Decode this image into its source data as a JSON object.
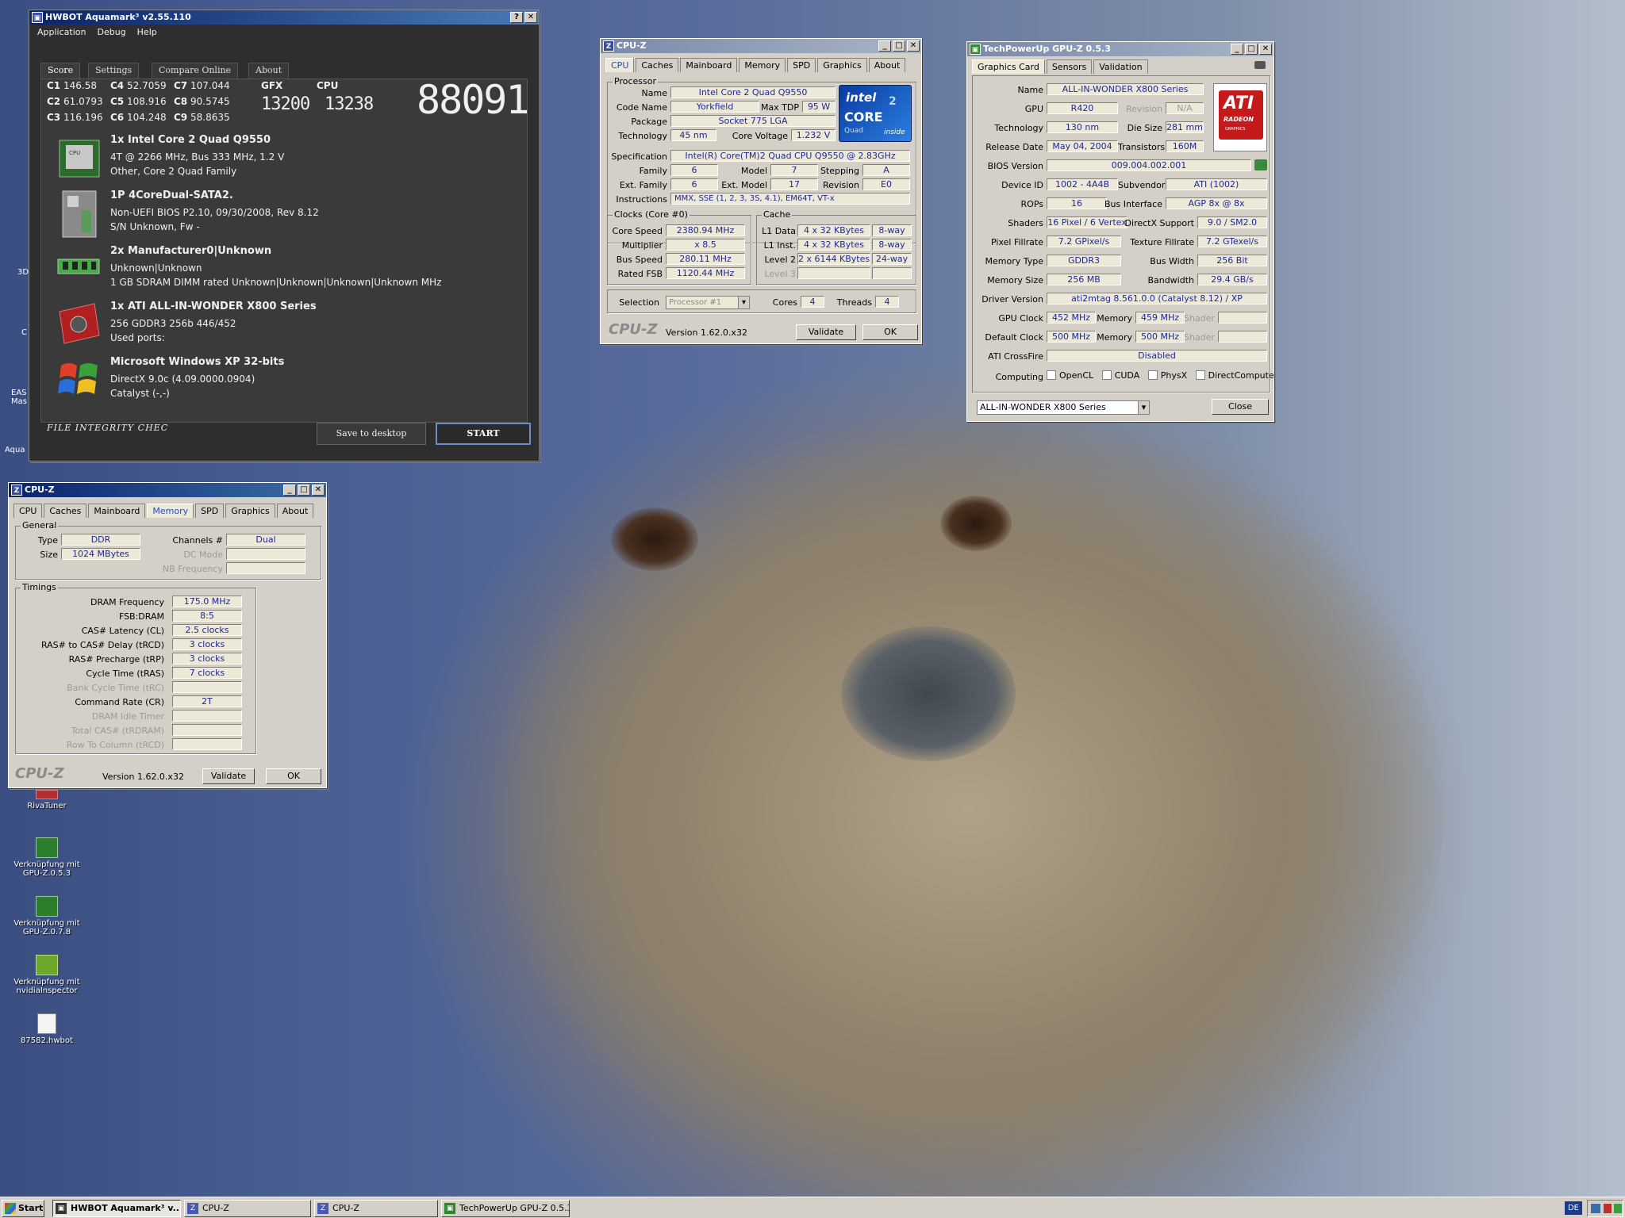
{
  "aquamark": {
    "title": "HWBOT Aquamark³ v2.55.110",
    "menu": [
      "Application",
      "Debug",
      "Help"
    ],
    "tabs": [
      "Score",
      "Settings",
      "Compare Online",
      "About"
    ],
    "scores": [
      {
        "k": "C1",
        "v": "146.58"
      },
      {
        "k": "C4",
        "v": "52.7059"
      },
      {
        "k": "C7",
        "v": "107.044"
      },
      {
        "k": "C2",
        "v": "61.0793"
      },
      {
        "k": "C5",
        "v": "108.916"
      },
      {
        "k": "C8",
        "v": "90.5745"
      },
      {
        "k": "C3",
        "v": "116.196"
      },
      {
        "k": "C6",
        "v": "104.248"
      },
      {
        "k": "C9",
        "v": "58.8635"
      }
    ],
    "gfx_label": "GFX",
    "cpu_label": "CPU",
    "gfx": "13200",
    "cpu": "13238",
    "total": "88091",
    "hw": [
      {
        "t": "1x Intel Core 2 Quad  Q9550",
        "l": [
          "4T @ 2266 MHz, Bus 333 MHz, 1.2 V",
          "Other, Core 2 Quad Family"
        ]
      },
      {
        "t": "1P  4CoreDual-SATA2.",
        "l": [
          "Non-UEFI BIOS P2.10, 09/30/2008, Rev 8.12",
          "S/N Unknown, Fw -"
        ]
      },
      {
        "t": "2x Manufacturer0|Unknown",
        "l": [
          "Unknown|Unknown",
          "1 GB SDRAM DIMM rated Unknown|Unknown|Unknown|Unknown MHz"
        ]
      },
      {
        "t": "1x ATI ALL-IN-WONDER X800 Series",
        "l": [
          "256 GDDR3 256b 446/452",
          "Used ports:"
        ]
      },
      {
        "t": "Microsoft Windows XP 32-bits",
        "l": [
          "DirectX 9.0c (4.09.0000.0904)",
          "Catalyst (-,-)"
        ]
      }
    ],
    "integrity": "FILE INTEGRITY CHEC",
    "save": "Save to desktop",
    "start": "START"
  },
  "cpuz_mem": {
    "title": "CPU-Z",
    "tabs": [
      "CPU",
      "Caches",
      "Mainboard",
      "Memory",
      "SPD",
      "Graphics",
      "About"
    ],
    "general": "General",
    "timings": "Timings",
    "type_l": "Type",
    "type": "DDR",
    "size_l": "Size",
    "size": "1024 MBytes",
    "ch_l": "Channels #",
    "ch": "Dual",
    "dc_l": "DC Mode",
    "nb_l": "NB Frequency",
    "rows": [
      {
        "l": "DRAM Frequency",
        "v": "175.0 MHz"
      },
      {
        "l": "FSB:DRAM",
        "v": "8:5"
      },
      {
        "l": "CAS# Latency (CL)",
        "v": "2.5 clocks"
      },
      {
        "l": "RAS# to CAS# Delay (tRCD)",
        "v": "3 clocks"
      },
      {
        "l": "RAS# Precharge (tRP)",
        "v": "3 clocks"
      },
      {
        "l": "Cycle Time (tRAS)",
        "v": "7 clocks"
      },
      {
        "l": "Bank Cycle Time (tRC)",
        "v": ""
      },
      {
        "l": "Command Rate (CR)",
        "v": "2T"
      },
      {
        "l": "DRAM Idle Timer",
        "v": ""
      },
      {
        "l": "Total CAS# (tRDRAM)",
        "v": ""
      },
      {
        "l": "Row To Column (tRCD)",
        "v": ""
      }
    ],
    "brand": "CPU-Z",
    "version": "Version 1.62.0.x32",
    "validate": "Validate",
    "ok": "OK"
  },
  "cpuz_cpu": {
    "title": "CPU-Z",
    "tabs": [
      "CPU",
      "Caches",
      "Mainboard",
      "Memory",
      "SPD",
      "Graphics",
      "About"
    ],
    "processor": "Processor",
    "name_l": "Name",
    "name": "Intel Core 2 Quad Q9550",
    "code_l": "Code Name",
    "code": "Yorkfield",
    "tdp_l": "Max TDP",
    "tdp": "95 W",
    "pkg_l": "Package",
    "pkg": "Socket 775 LGA",
    "tech_l": "Technology",
    "tech": "45 nm",
    "volt_l": "Core Voltage",
    "volt": "1.232 V",
    "spec_l": "Specification",
    "spec": "Intel(R) Core(TM)2 Quad CPU    Q9550  @ 2.83GHz",
    "fam_l": "Family",
    "fam": "6",
    "model_l": "Model",
    "model": "7",
    "step_l": "Stepping",
    "step": "A",
    "efam_l": "Ext. Family",
    "efam": "6",
    "emod_l": "Ext. Model",
    "emod": "17",
    "rev_l": "Revision",
    "rev": "E0",
    "inst_l": "Instructions",
    "inst": "MMX, SSE (1, 2, 3, 3S, 4.1), EM64T, VT-x",
    "clocks": "Clocks (Core #0)",
    "cache": "Cache",
    "cs_l": "Core Speed",
    "cs": "2380.94 MHz",
    "mul_l": "Multiplier",
    "mul": "x 8.5",
    "bus_l": "Bus Speed",
    "bus": "280.11 MHz",
    "fsb_l": "Rated FSB",
    "fsb": "1120.44 MHz",
    "l1d_l": "L1 Data",
    "l1d": "4 x 32 KBytes",
    "l1d_w": "8-way",
    "l1i_l": "L1 Inst.",
    "l1i": "4 x 32 KBytes",
    "l1i_w": "8-way",
    "l2_l": "Level 2",
    "l2": "2 x 6144 KBytes",
    "l2_w": "24-way",
    "l3_l": "Level 3",
    "sel_l": "Selection",
    "sel": "Processor #1",
    "cores_l": "Cores",
    "cores": "4",
    "thr_l": "Threads",
    "thr": "4",
    "logo_top": "intel",
    "logo_mid": "CORE",
    "logo_sub": "2",
    "logo_q": "Quad",
    "logo_in": "inside",
    "brand": "CPU-Z",
    "version": "Version 1.62.0.x32",
    "validate": "Validate",
    "ok": "OK"
  },
  "gpuz": {
    "title": "TechPowerUp GPU-Z 0.5.3",
    "tabs": [
      "Graphics Card",
      "Sensors",
      "Validation"
    ],
    "name_l": "Name",
    "name": "ALL-IN-WONDER X800 Series",
    "gpu_l": "GPU",
    "gpu": "R420",
    "rev_l": "Revision",
    "rev": "N/A",
    "tech_l": "Technology",
    "tech": "130 nm",
    "die_l": "Die Size",
    "die": "281 mm²",
    "rel_l": "Release Date",
    "rel": "May 04, 2004",
    "tr_l": "Transistors",
    "tr": "160M",
    "bios_l": "BIOS Version",
    "bios": "009.004.002.001",
    "dev_l": "Device ID",
    "dev": "1002 - 4A4B",
    "sub_l": "Subvendor",
    "sub": "ATI (1002)",
    "rop_l": "ROPs",
    "rop": "16",
    "bi_l": "Bus Interface",
    "bi": "AGP 8x @ 8x",
    "sh_l": "Shaders",
    "sh": "16 Pixel / 6 Vertex",
    "dx_l": "DirectX Support",
    "dx": "9.0 / SM2.0",
    "pf_l": "Pixel Fillrate",
    "pf": "7.2 GPixel/s",
    "tf_l": "Texture Fillrate",
    "tf": "7.2 GTexel/s",
    "mt_l": "Memory Type",
    "mt": "GDDR3",
    "bw_l": "Bus Width",
    "bw": "256 Bit",
    "ms_l": "Memory Size",
    "ms": "256 MB",
    "band_l": "Bandwidth",
    "band": "29.4 GB/s",
    "drv_l": "Driver Version",
    "drv": "ati2mtag 8.561.0.0 (Catalyst 8.12) / XP",
    "gc_l": "GPU Clock",
    "gc": "452 MHz",
    "mem_l": "Memory",
    "mem": "459 MHz",
    "shd_l": "Shader",
    "dc_l": "Default Clock",
    "dc": "500 MHz",
    "dmem": "500 MHz",
    "cf_l": "ATI CrossFire",
    "cf": "Disabled",
    "comp_l": "Computing",
    "c1": "OpenCL",
    "c2": "CUDA",
    "c3": "PhysX",
    "c4": "DirectCompute",
    "sel": "ALL-IN-WONDER X800 Series",
    "close": "Close",
    "logo1": "ATI",
    "logo2": "RADEON",
    "logo3": "GRAPHICS"
  },
  "desktop": [
    {
      "l": "RivaTuner"
    },
    {
      "l": "Verknüpfung mit GPU-Z.0.5.3"
    },
    {
      "l": "Verknüpfung mit GPU-Z.0.7.8"
    },
    {
      "l": "Verknüpfung mit nvidiaInspector"
    },
    {
      "l": "87582.hwbot"
    }
  ],
  "desktop_partial": [
    "3D",
    "C",
    "EAS Mas",
    "Aqua"
  ],
  "taskbar": {
    "start": "Start",
    "items": [
      "HWBOT Aquamark³ v...",
      "CPU-Z",
      "CPU-Z",
      "TechPowerUp GPU-Z 0.5.3"
    ],
    "lang": "DE"
  },
  "colors": {
    "title_blue": "#0a246a",
    "value_blue": "#1e2896",
    "aq_bg": "#2e2e2e"
  }
}
